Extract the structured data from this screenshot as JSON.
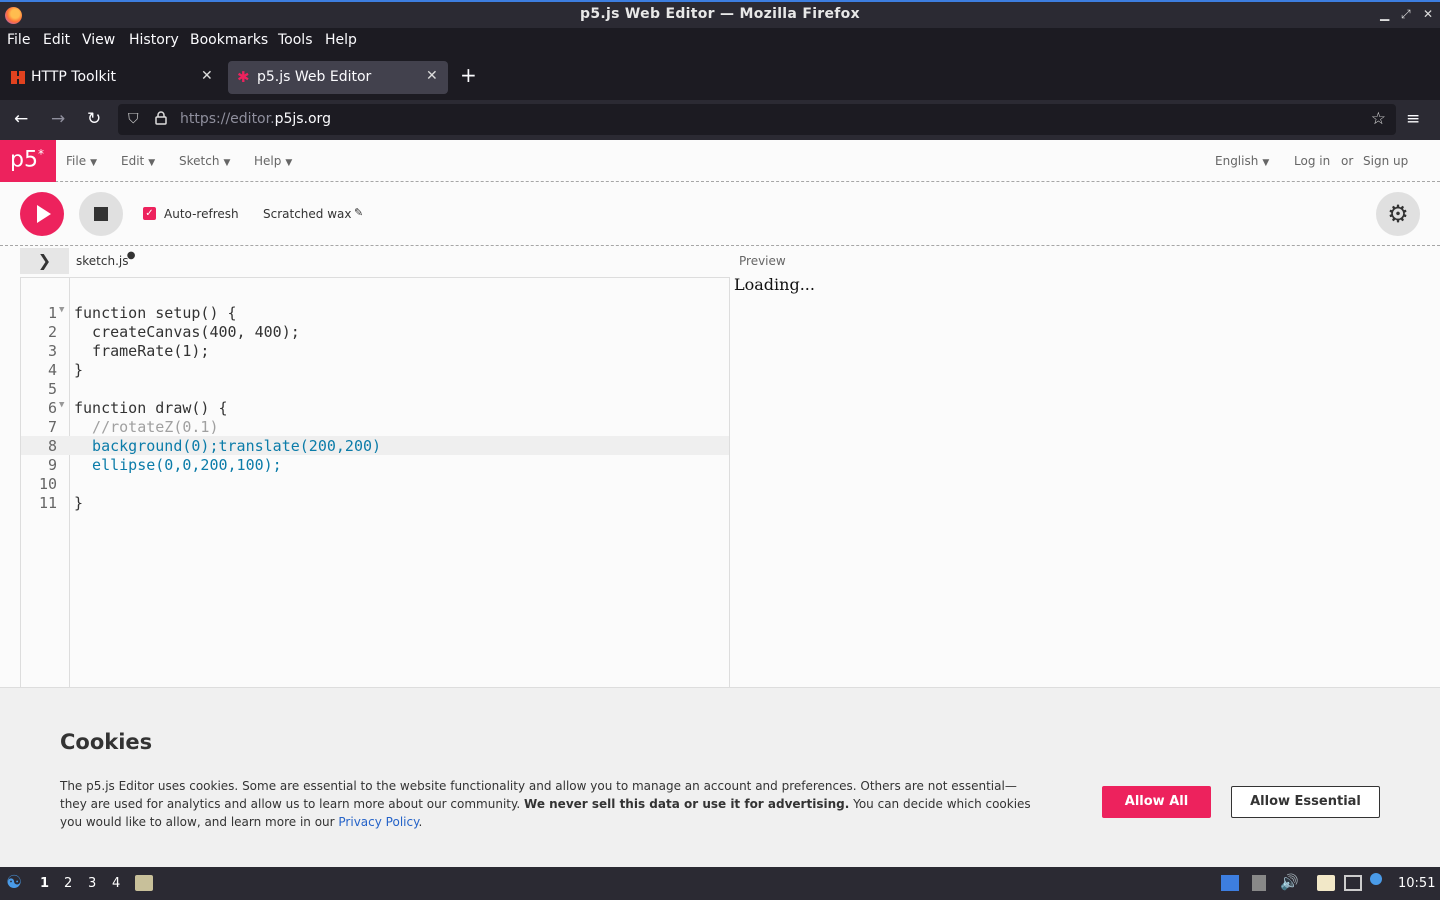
{
  "window": {
    "title": "p5.js Web Editor — Mozilla Firefox"
  },
  "menubar": [
    "File",
    "Edit",
    "View",
    "History",
    "Bookmarks",
    "Tools",
    "Help"
  ],
  "tabs": [
    {
      "label": "HTTP Toolkit",
      "active": false
    },
    {
      "label": "p5.js Web Editor",
      "active": true
    }
  ],
  "nav": {
    "url_prefix": "https://editor.",
    "url_domain": "p5js.org"
  },
  "p5": {
    "logo": "p5",
    "logo_sup": "*",
    "menus": [
      "File",
      "Edit",
      "Sketch",
      "Help"
    ],
    "language": "English",
    "login": "Log in",
    "or": "or",
    "signup": "Sign up"
  },
  "toolbar": {
    "auto_refresh_label": "Auto-refresh",
    "auto_refresh_checked": true,
    "sketch_name": "Scratched wax"
  },
  "editor": {
    "filename": "sketch.js",
    "unsaved_dot": "●",
    "lines": [
      "function setup() {",
      "  createCanvas(400, 400);",
      "  frameRate(1);",
      "}",
      "",
      "function draw() {",
      "  //rotateZ(0.1)",
      "  background(0);translate(200,200)",
      "  ellipse(0,0,200,100);",
      "",
      "}"
    ],
    "current_line": 8
  },
  "preview": {
    "label": "Preview",
    "loading": "Loading..."
  },
  "cookies": {
    "title": "Cookies",
    "text_1": "The p5.js Editor uses cookies. Some are essential to the website functionality and allow you to manage an account and preferences. Others are not essential—they are used for analytics and allow us to learn more about our community. ",
    "text_bold": "We never sell this data or use it for advertising.",
    "text_2": " You can decide which cookies you would like to allow, and learn more in our ",
    "link": "Privacy Policy",
    "text_end": ".",
    "allow_all": "Allow All",
    "allow_essential": "Allow Essential"
  },
  "taskbar": {
    "workspaces": [
      "1",
      "2",
      "3",
      "4"
    ],
    "clock": "10:51"
  },
  "colors": {
    "accent": "#ed225d",
    "chrome_dark": "#1c1b22",
    "chrome_mid": "#2b2a33"
  }
}
